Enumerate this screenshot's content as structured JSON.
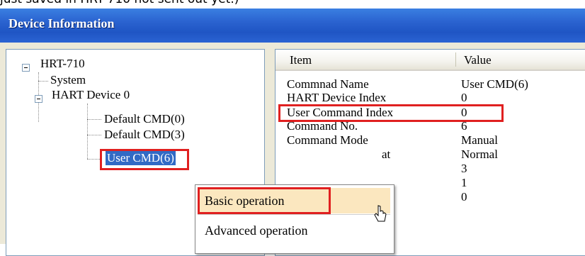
{
  "caption": "just saved in HRT-710 not sent out yet.)",
  "window": {
    "title": "Device Information"
  },
  "tree": {
    "root": "HRT-710",
    "system": "System",
    "device": "HART Device 0",
    "children": [
      "Default CMD(0)",
      "Default CMD(3)",
      "User CMD(6)"
    ]
  },
  "list": {
    "columns": [
      "Item",
      "Value"
    ],
    "rows": [
      {
        "item": "Commnad Name",
        "value": "User CMD(6)"
      },
      {
        "item": "HART Device Index",
        "value": "0"
      },
      {
        "item": "User Command Index",
        "value": "0"
      },
      {
        "item": "Command No.",
        "value": "6"
      },
      {
        "item": "Command Mode",
        "value": "Manual"
      },
      {
        "item": "at",
        "value": "Normal"
      },
      {
        "item": "",
        "value": "3"
      },
      {
        "item": "",
        "value": "1"
      },
      {
        "item": "",
        "value": "0"
      }
    ]
  },
  "context_menu": {
    "items": [
      "Basic operation",
      "Advanced operation"
    ]
  },
  "highlight_color": "#e02020",
  "selection_color": "#316ac5"
}
